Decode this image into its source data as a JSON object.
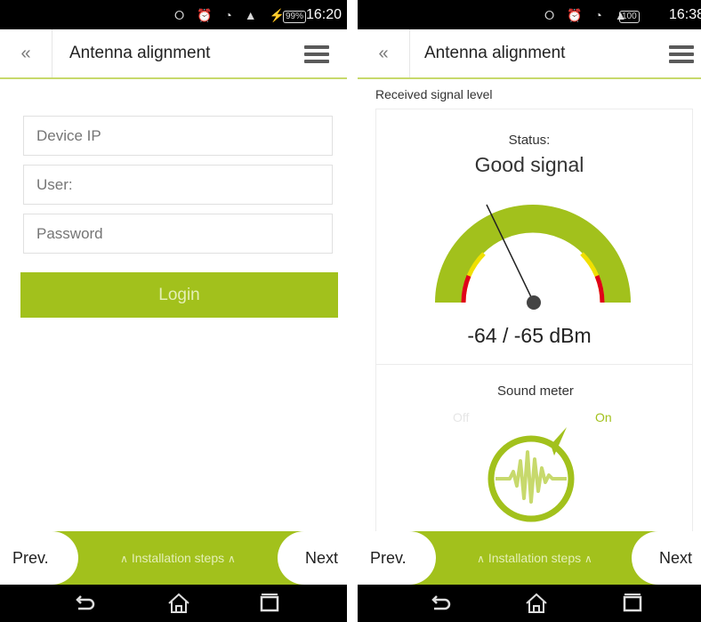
{
  "left_screen": {
    "statusbar": {
      "time": "16:20",
      "battery": "99%"
    },
    "appbar": {
      "back_glyph": "«",
      "title": "Antenna alignment",
      "menu_icon": "hamburger-icon"
    },
    "form": {
      "device_ip_placeholder": "Device IP",
      "user_placeholder": "User:",
      "password_placeholder": "Password",
      "login_label": "Login"
    },
    "footer": {
      "prev_label": "Prev.",
      "steps_label": "Installation steps",
      "next_label": "Next"
    }
  },
  "right_screen": {
    "statusbar": {
      "time": "16:38",
      "battery": "100"
    },
    "appbar": {
      "back_glyph": "«",
      "title": "Antenna alignment",
      "menu_icon": "hamburger-icon"
    },
    "section_label": "Received signal level",
    "signal": {
      "status_label": "Status:",
      "status_value": "Good signal",
      "reading": "-64 / -65 dBm"
    },
    "sound_meter": {
      "title": "Sound meter",
      "off_label": "Off",
      "on_label": "On",
      "selected": "On"
    },
    "footer": {
      "prev_label": "Prev.",
      "steps_label": "Installation steps",
      "next_label": "Next"
    }
  },
  "colors": {
    "accent": "#a2c11c",
    "warning": "#f0e000",
    "danger": "#e0001a"
  }
}
